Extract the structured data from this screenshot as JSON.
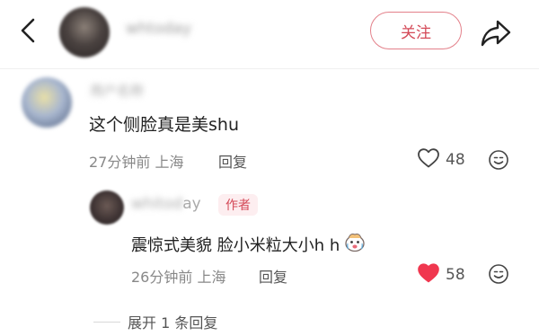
{
  "header": {
    "username": "whtoday",
    "follow_label": "关注"
  },
  "comment": {
    "username": "用户名称",
    "text": "这个侧脸真是美shu",
    "time_location": "27分钟前 上海",
    "reply_label": "回复",
    "like_count": "48",
    "liked": false
  },
  "reply": {
    "username_blurred": "whitod",
    "username_visible": "ay",
    "author_badge": "作者",
    "text": "震惊式美貌 脸小米粒大小h h",
    "time_location": "26分钟前 上海",
    "reply_label": "回复",
    "like_count": "58",
    "liked": true
  },
  "expand": {
    "label": "展开 1 条回复"
  },
  "colors": {
    "accent": "#d44a58",
    "like_red": "#f0374f",
    "muted": "#888888"
  }
}
